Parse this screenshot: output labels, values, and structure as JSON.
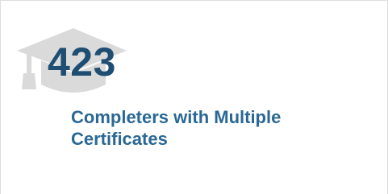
{
  "card": {
    "value": "423",
    "label": "Completers with Multiple Certificates",
    "icon": "graduation-cap-icon"
  },
  "colors": {
    "value": "#1f4e73",
    "label": "#2a6896",
    "icon": "#dadada"
  }
}
